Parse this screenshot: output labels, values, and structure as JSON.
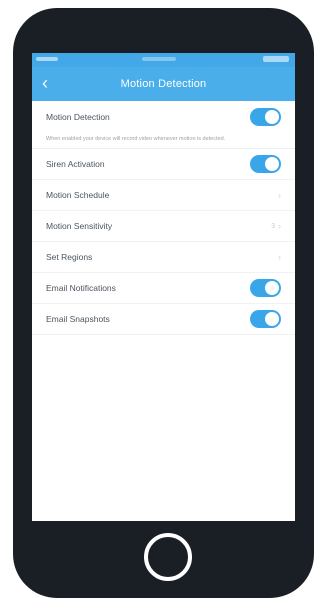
{
  "header": {
    "title": "Motion Detection",
    "back_glyph": "‹"
  },
  "settings": {
    "motion_detection": {
      "label": "Motion Detection",
      "enabled": true
    },
    "description": "When enabled your device will record video whenever motion is detected.",
    "siren_activation": {
      "label": "Siren Activation",
      "enabled": true
    },
    "motion_schedule": {
      "label": "Motion Schedule"
    },
    "motion_sensitivity": {
      "label": "Motion Sensitivity",
      "value": "3"
    },
    "set_regions": {
      "label": "Set Regions"
    },
    "email_notifications": {
      "label": "Email Notifications",
      "enabled": true
    },
    "email_snapshots": {
      "label": "Email Snapshots",
      "enabled": true
    }
  },
  "icons": {
    "back": "chevron-left-icon",
    "disclosure": "chevron-right-icon",
    "home": "home-button"
  },
  "colors": {
    "accent": "#4aaeea",
    "toggle_on": "#3aa6ea",
    "device": "#1a1e25"
  }
}
